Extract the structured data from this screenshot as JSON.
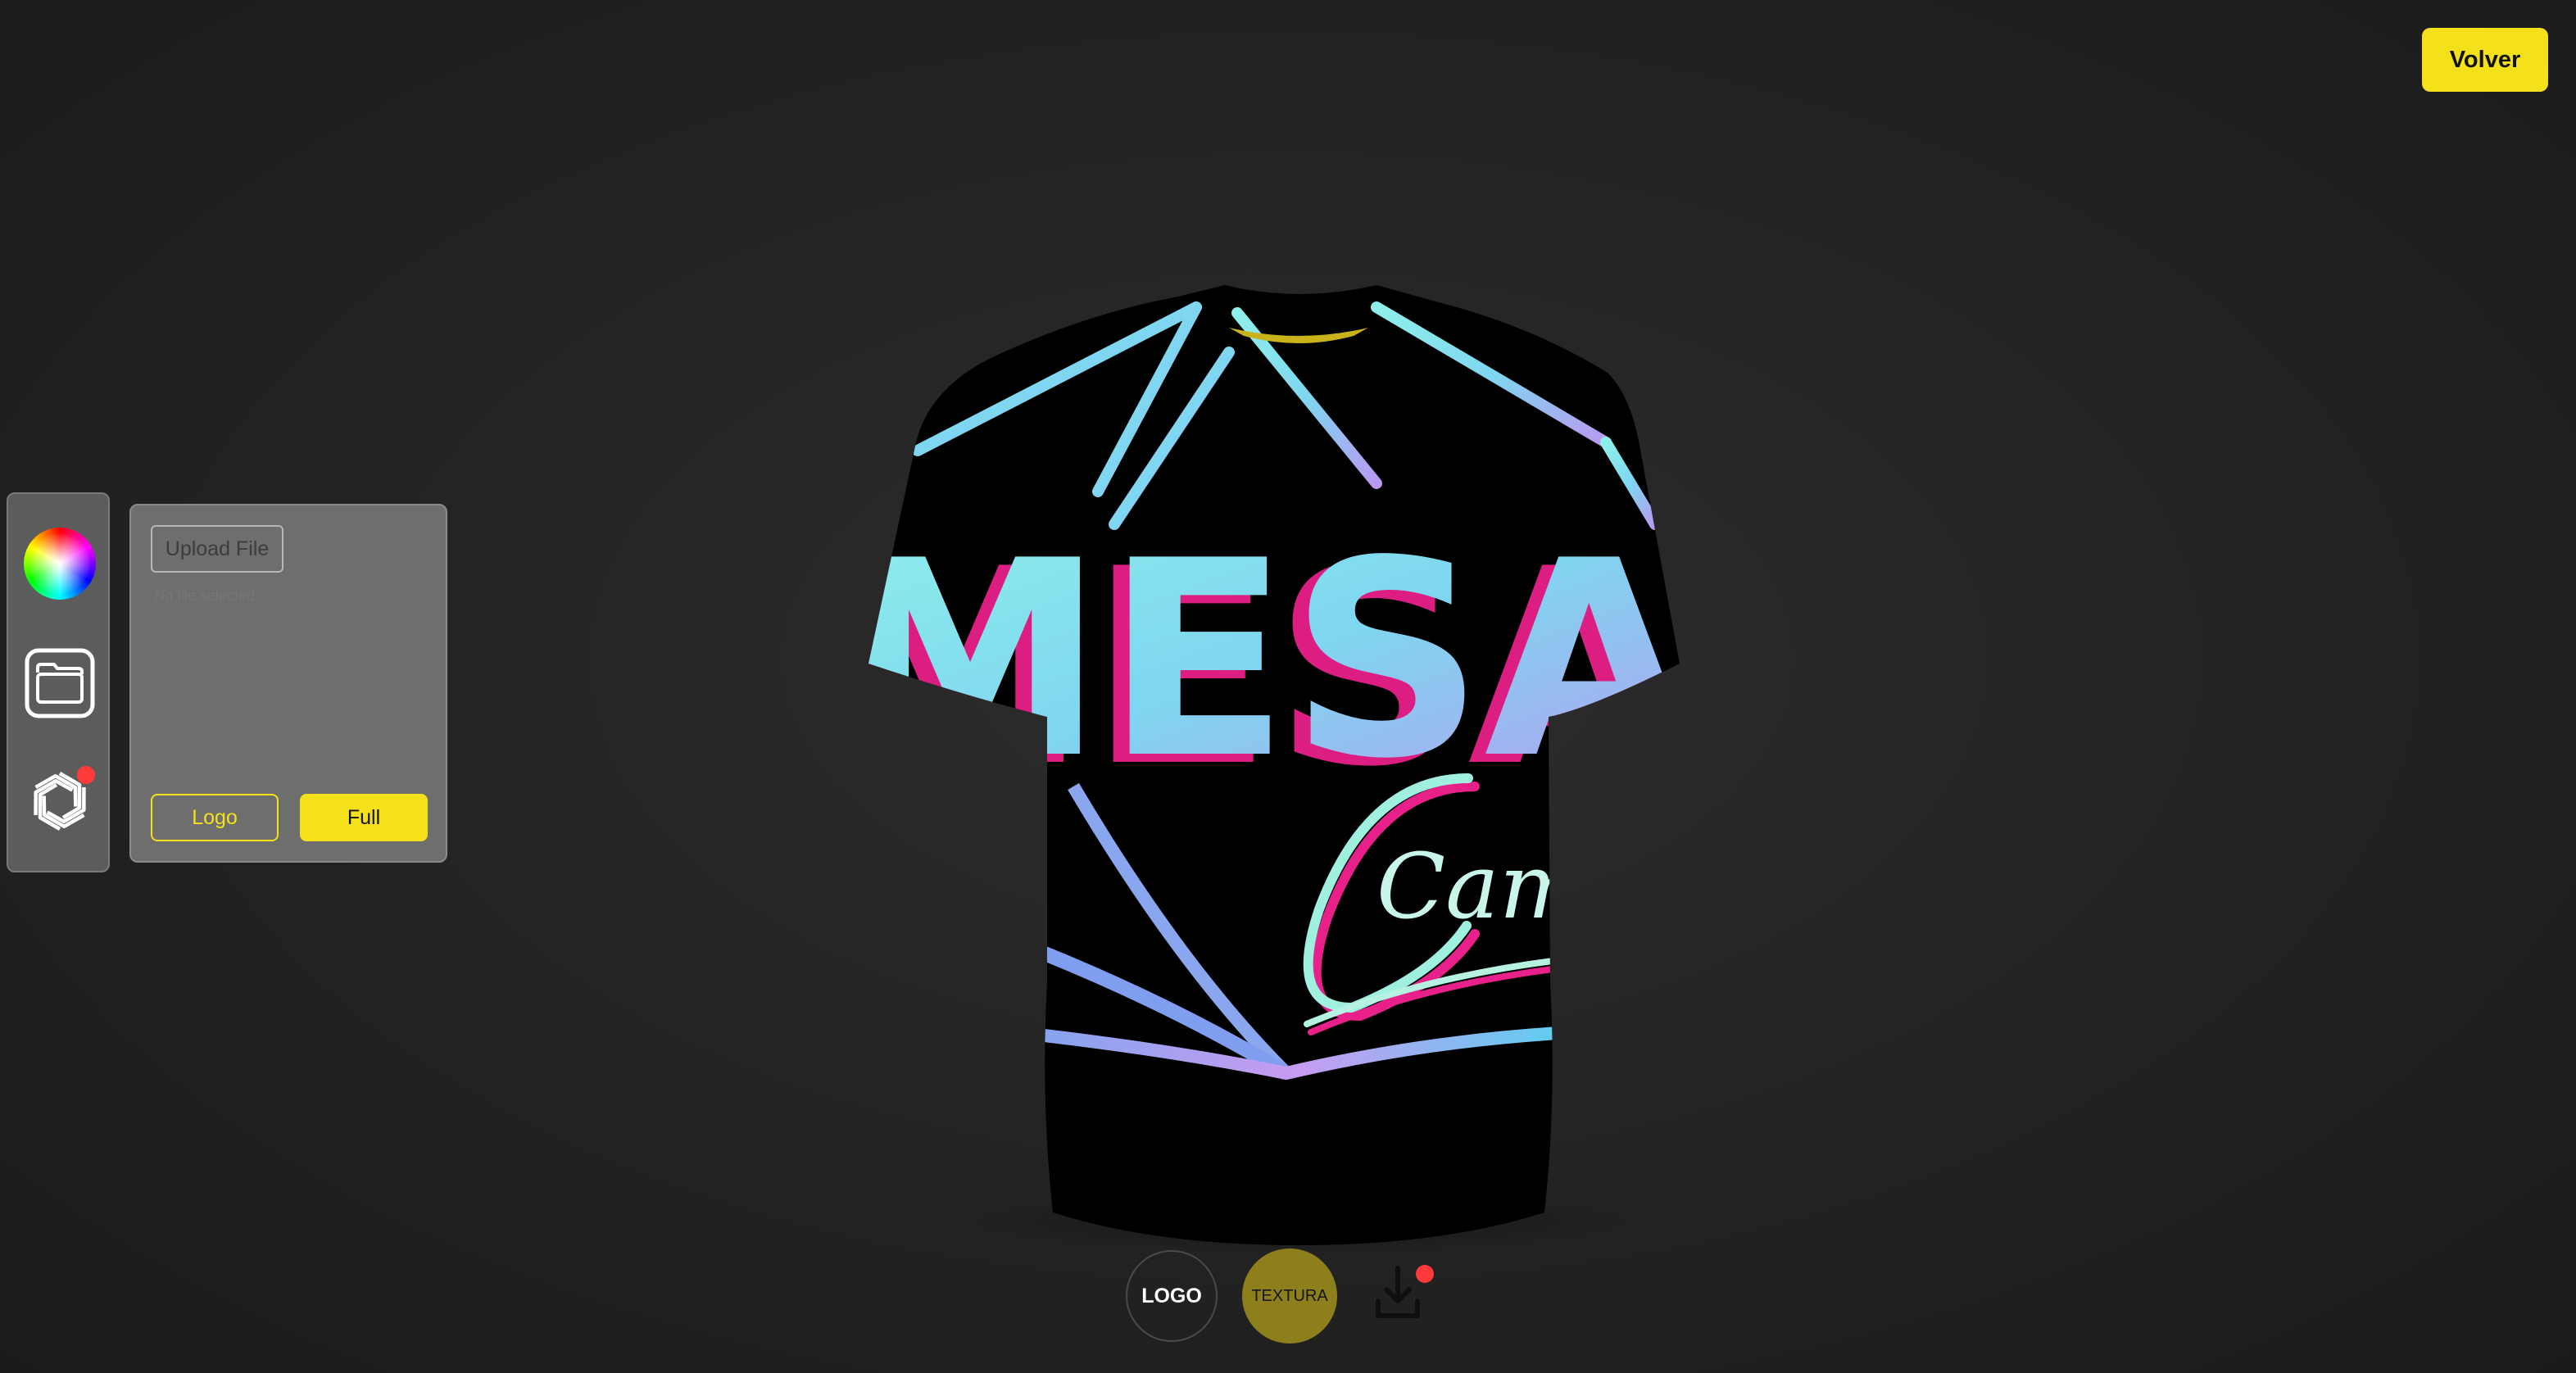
{
  "header": {
    "back_label": "Volver"
  },
  "toolbar": {
    "tools": [
      {
        "name": "color-picker",
        "icon": "color-wheel-icon"
      },
      {
        "name": "file-picker",
        "icon": "folder-icon"
      },
      {
        "name": "ai-picker",
        "icon": "openai-icon",
        "badge_color": "#ff3a3a"
      }
    ]
  },
  "file_panel": {
    "upload_label": "Upload File",
    "status_text": "No file selected",
    "logo_label": "Logo",
    "full_label": "Full"
  },
  "shirt": {
    "base_color": "#000000",
    "texture_text": "MESA",
    "script_text": "Cam"
  },
  "bottom_controls": {
    "logo_label": "LOGO",
    "texture_label": "TEXTURA",
    "download_icon": "download-icon",
    "badge_color": "#ff3a3a"
  },
  "colors": {
    "accent": "#f5e11a",
    "texture_active": "#8d7f1c",
    "background": "#262626"
  }
}
